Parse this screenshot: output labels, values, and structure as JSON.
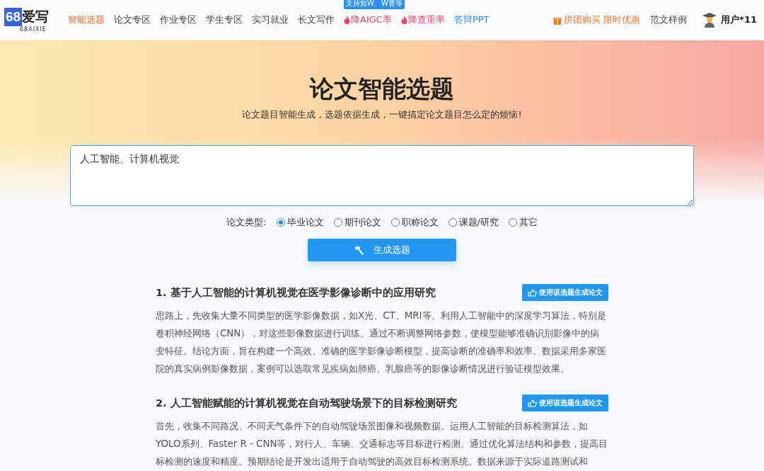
{
  "logo": {
    "mark": "68",
    "name": "爱写",
    "sub": "68AIXIE"
  },
  "nav": [
    {
      "label": "智能选题",
      "selected": true,
      "kind": "plain"
    },
    {
      "label": "论文专区",
      "selected": false,
      "kind": "plain"
    },
    {
      "label": "作业专区",
      "selected": false,
      "kind": "plain"
    },
    {
      "label": "学生专区",
      "selected": false,
      "kind": "plain"
    },
    {
      "label": "实习就业",
      "selected": false,
      "kind": "plain"
    },
    {
      "label": "长文写作",
      "selected": false,
      "kind": "plain"
    },
    {
      "label": "降AIGC率",
      "selected": false,
      "kind": "hot",
      "badge": "支持知W、W普等"
    },
    {
      "label": "降查重率",
      "selected": false,
      "kind": "hot"
    },
    {
      "label": "答辩PPT",
      "selected": false,
      "kind": "accent"
    }
  ],
  "promo": "拼团购买 限时优惠",
  "samples": "范文样例",
  "user": "用户*11",
  "title": "论文智能选题",
  "subtitle": "论文题目智能生成，选题依据生成，一键搞定论文题目怎么定的烦恼!",
  "topic_input": {
    "value": "人工智能、计算机视觉"
  },
  "paper_type": {
    "label": "论文类型:",
    "options": [
      {
        "label": "毕业论文",
        "selected": true
      },
      {
        "label": "期刊论文",
        "selected": false
      },
      {
        "label": "职称论文",
        "selected": false
      },
      {
        "label": "课题/研究",
        "selected": false
      },
      {
        "label": "其它",
        "selected": false
      }
    ]
  },
  "generate_button": "生成选题",
  "results": [
    {
      "title": "1. 基于人工智能的计算机视觉在医学影像诊断中的应用研究",
      "button": "使用该选题生成论文",
      "body": "思路上，先收集大量不同类型的医学影像数据，如X光、CT、MRI等。利用人工智能中的深度学习算法，特别是卷积神经网络（CNN），对这些影像数据进行训练。通过不断调整网络参数，使模型能够准确识别影像中的病变特征。结论方面，旨在构建一个高效、准确的医学影像诊断模型，提高诊断的准确率和效率。数据采用多家医院的真实病例影像数据，案例可以选取常见疾病如肺癌、乳腺癌等的影像诊断情况进行验证模型效果。"
    },
    {
      "title": "2. 人工智能赋能的计算机视觉在自动驾驶场景下的目标检测研究",
      "button": "使用该选题生成论文",
      "body": "首先，收集不同路况、不同天气条件下的自动驾驶场景图像和视频数据。运用人工智能的目标检测算法，如YOLO系列、Faster R - CNN等，对行人、车辆、交通标志等目标进行检测。通过优化算法结构和参数，提高目标检测的速度和精度。预期结论是开发出适用于自动驾驶的高效目标检测系统。数据来源于实际道路测试和"
    }
  ]
}
